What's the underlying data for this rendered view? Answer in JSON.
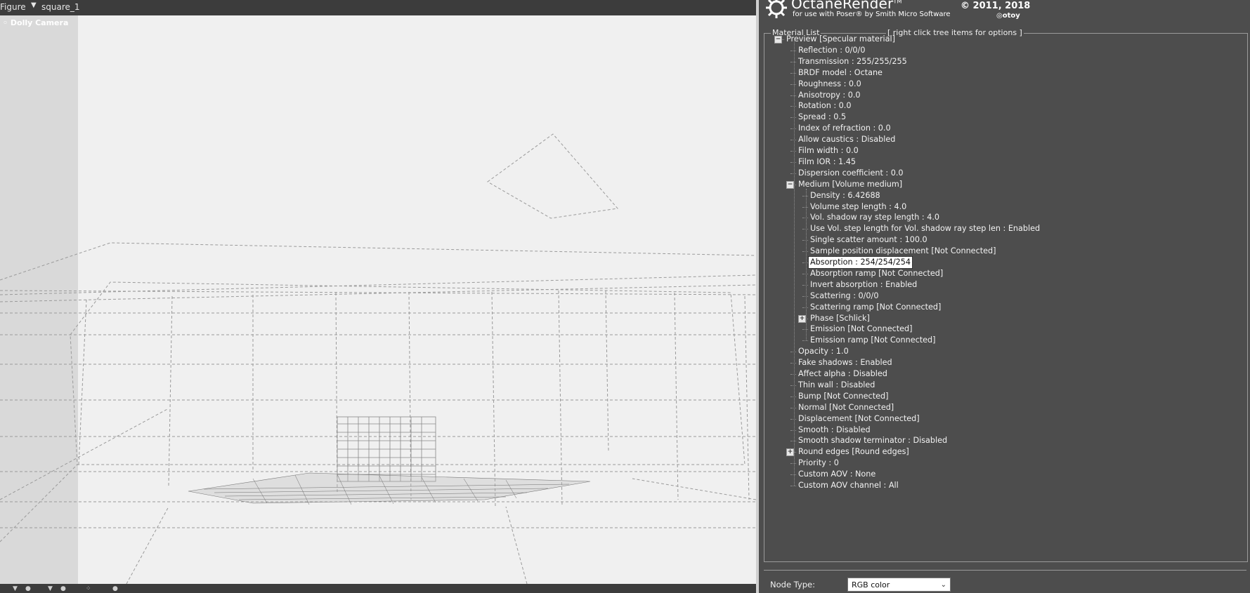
{
  "viewport": {
    "figure_menu": "Figure",
    "selected_object": "square_1",
    "camera_label": "Dolly Camera"
  },
  "logo": {
    "title": "OctaneRender",
    "trademark": "TM",
    "subtitle": "for use with Poser® by Smith Micro Software",
    "copyright": "© 2011, 2018",
    "brand": "otoy"
  },
  "material_list": {
    "group_label": "Material List",
    "hint": "[ right click tree items for options ]",
    "rows": [
      {
        "text": "Preview   [Specular material]",
        "depth": 0,
        "toggle": "−"
      },
      {
        "text": "Reflection  :  0/0/0",
        "depth": 1
      },
      {
        "text": "Transmission  :  255/255/255",
        "depth": 1
      },
      {
        "text": "BRDF model  :  Octane",
        "depth": 1
      },
      {
        "text": "Roughness  :  0.0",
        "depth": 1
      },
      {
        "text": "Anisotropy  :  0.0",
        "depth": 1
      },
      {
        "text": "Rotation  :  0.0",
        "depth": 1
      },
      {
        "text": "Spread  :  0.5",
        "depth": 1
      },
      {
        "text": "Index of refraction  :  0.0",
        "depth": 1
      },
      {
        "text": "Allow caustics  :  Disabled",
        "depth": 1
      },
      {
        "text": "Film width  :  0.0",
        "depth": 1
      },
      {
        "text": "Film IOR  :  1.45",
        "depth": 1
      },
      {
        "text": "Dispersion coefficient  :  0.0",
        "depth": 1
      },
      {
        "text": "Medium   [Volume medium]",
        "depth": 1,
        "toggle": "−"
      },
      {
        "text": "Density  :  6.42688",
        "depth": 2
      },
      {
        "text": "Volume step length  :  4.0",
        "depth": 2
      },
      {
        "text": "Vol. shadow ray step length  :  4.0",
        "depth": 2
      },
      {
        "text": "Use Vol. step length for Vol. shadow ray step len  :  Enabled",
        "depth": 2
      },
      {
        "text": "Single scatter amount  :  100.0",
        "depth": 2
      },
      {
        "text": "Sample position displacement   [Not Connected]",
        "depth": 2
      },
      {
        "text": "Absorption  :  254/254/254",
        "depth": 2,
        "selected": true
      },
      {
        "text": "Absorption ramp   [Not Connected]",
        "depth": 2
      },
      {
        "text": "Invert absorption  :  Enabled",
        "depth": 2
      },
      {
        "text": "Scattering  :  0/0/0",
        "depth": 2
      },
      {
        "text": "Scattering ramp   [Not Connected]",
        "depth": 2
      },
      {
        "text": "Phase   [Schlick]",
        "depth": 2,
        "toggle": "+"
      },
      {
        "text": "Emission   [Not Connected]",
        "depth": 2
      },
      {
        "text": "Emission ramp   [Not Connected]",
        "depth": 2
      },
      {
        "text": "Opacity  :  1.0",
        "depth": 1
      },
      {
        "text": "Fake shadows  :  Enabled",
        "depth": 1
      },
      {
        "text": "Affect alpha  :  Disabled",
        "depth": 1
      },
      {
        "text": "Thin wall  :  Disabled",
        "depth": 1
      },
      {
        "text": "Bump   [Not Connected]",
        "depth": 1
      },
      {
        "text": "Normal   [Not Connected]",
        "depth": 1
      },
      {
        "text": "Displacement   [Not Connected]",
        "depth": 1
      },
      {
        "text": "Smooth  :  Disabled",
        "depth": 1
      },
      {
        "text": "Smooth shadow terminator  :  Disabled",
        "depth": 1
      },
      {
        "text": "Round edges   [Round edges]",
        "depth": 1,
        "toggle": "+"
      },
      {
        "text": "Priority  :  0",
        "depth": 1
      },
      {
        "text": "Custom AOV  :  None",
        "depth": 1
      },
      {
        "text": "Custom AOV channel  :  All",
        "depth": 1
      }
    ]
  },
  "node_type": {
    "label": "Node Type:",
    "selected": "RGB color"
  }
}
